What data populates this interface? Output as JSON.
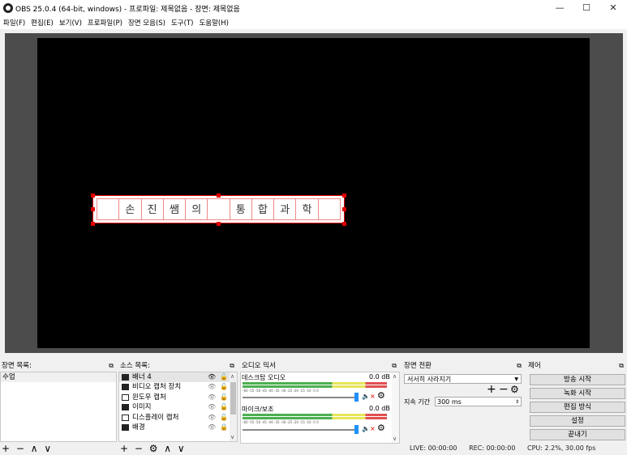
{
  "window": {
    "title": "OBS 25.0.4 (64-bit, windows) - 프로파일: 제목없음 - 장면: 제목없음"
  },
  "menu": [
    "파일(F)",
    "편집(E)",
    "보기(V)",
    "프로파일(P)",
    "장면 모음(S)",
    "도구(T)",
    "도움말(H)"
  ],
  "preview": {
    "banner_text": [
      "",
      "손",
      "진",
      "쌤",
      "의",
      "",
      "통",
      "합",
      "과",
      "학",
      ""
    ]
  },
  "scenes": {
    "title": "장면 목록:",
    "items": [
      "수업"
    ],
    "footer": "+ − ∧ ∨"
  },
  "sources": {
    "title": "소스 목록:",
    "items": [
      {
        "name": "배너 4",
        "icon": "image-icon"
      },
      {
        "name": "비디오 캡처 장치",
        "icon": "camera-icon"
      },
      {
        "name": "윈도우 캡처",
        "icon": "window-icon"
      },
      {
        "name": "이미지",
        "icon": "image-icon"
      },
      {
        "name": "디스플레이 캡처",
        "icon": "monitor-icon"
      },
      {
        "name": "배경",
        "icon": "image-icon"
      }
    ],
    "footer": "+ − ⚙ ∧ ∨"
  },
  "mixer": {
    "title": "오디오 믹서",
    "tracks": [
      {
        "name": "데스크탑 오디오",
        "db": "0.0 dB"
      },
      {
        "name": "마이크/보조",
        "db": "0.0 dB"
      }
    ],
    "ticks": "-60 -55 -50 -45 -40 -35 -30 -25 -20 -15 -10 -5 0"
  },
  "transitions": {
    "title": "장면 전환",
    "selected": "서서히 사라지기",
    "duration_label": "지속 기간",
    "duration_value": "300 ms"
  },
  "controls": {
    "title": "제어",
    "buttons": [
      "방송 시작",
      "녹화 시작",
      "편집 방식",
      "설정",
      "끝내기"
    ]
  },
  "status": {
    "live": "LIVE: 00:00:00",
    "rec": "REC: 00:00:00",
    "cpu": "CPU: 2.2%, 30.00 fps"
  },
  "colors": {
    "selection_red": "#e00000",
    "volume_blue": "#1e90ff"
  }
}
